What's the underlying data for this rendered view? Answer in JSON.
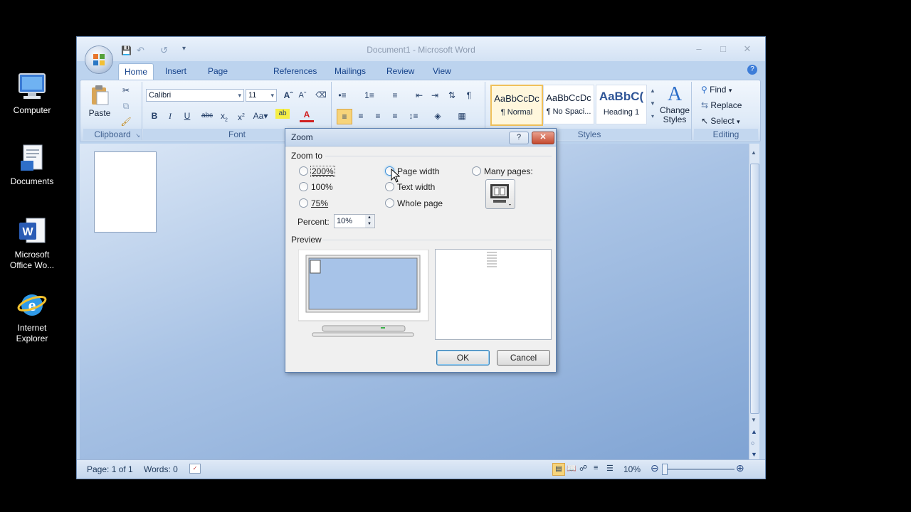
{
  "desktop": {
    "icons": [
      {
        "label": "Computer"
      },
      {
        "label": "Documents"
      },
      {
        "label": "Microsoft Office Wo..."
      },
      {
        "label": "Internet Explorer"
      }
    ]
  },
  "window": {
    "title": "Document1 - Microsoft Word",
    "quick_access": [
      "save-icon",
      "undo-icon",
      "redo-icon",
      "customize-icon"
    ],
    "tabs": [
      "Home",
      "Insert",
      "Page Layout",
      "References",
      "Mailings",
      "Review",
      "View"
    ],
    "active_tab": "Home"
  },
  "ribbon": {
    "clipboard": {
      "label": "Clipboard",
      "paste": "Paste"
    },
    "font": {
      "label": "Font",
      "family": "Calibri",
      "size": "11"
    },
    "styles": {
      "label": "Styles",
      "items": [
        {
          "preview": "AaBbCcDc",
          "name": "¶ Normal"
        },
        {
          "preview": "AaBbCcDc",
          "name": "¶ No Spaci..."
        },
        {
          "preview": "AaBbC(",
          "name": "Heading 1"
        }
      ],
      "change_styles": "Change Styles"
    },
    "editing": {
      "label": "Editing",
      "find": "Find",
      "replace": "Replace",
      "select": "Select"
    }
  },
  "statusbar": {
    "page": "Page: 1 of 1",
    "words": "Words: 0",
    "zoom": "10%"
  },
  "dialog": {
    "title": "Zoom",
    "help": "?",
    "zoom_to_label": "Zoom to",
    "options_col1": [
      "200%",
      "100%",
      "75%"
    ],
    "options_col2": [
      "Page width",
      "Text width",
      "Whole page"
    ],
    "many_pages": "Many pages:",
    "percent_label": "Percent:",
    "percent_value": "10%",
    "preview_label": "Preview",
    "ok": "OK",
    "cancel": "Cancel"
  },
  "colors": {
    "accent": "#15428b",
    "ribbon": "#dde9f7",
    "doc_bg": "#a9c3e5"
  }
}
